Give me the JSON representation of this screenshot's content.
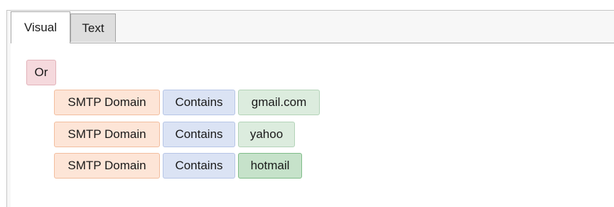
{
  "tabs": {
    "visual": "Visual",
    "text": "Text"
  },
  "query": {
    "operator": "Or",
    "rules": [
      {
        "field": "SMTP Domain",
        "condition": "Contains",
        "value": "gmail.com"
      },
      {
        "field": "SMTP Domain",
        "condition": "Contains",
        "value": "yahoo"
      },
      {
        "field": "SMTP Domain",
        "condition": "Contains",
        "value": "hotmail"
      }
    ]
  },
  "colors": {
    "operator_chip": "#f5d9dd",
    "field_chip": "#fde5d7",
    "condition_chip": "#dbe3f4",
    "value_chip": "#dcecde",
    "value_chip_selected": "#c6e2ca"
  }
}
